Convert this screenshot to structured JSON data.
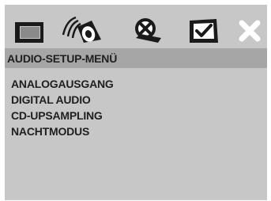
{
  "tabs": [
    {
      "icon": "general-setup-icon"
    },
    {
      "icon": "audio-setup-icon"
    },
    {
      "icon": "video-setup-icon"
    },
    {
      "icon": "preferences-icon"
    },
    {
      "icon": "exit-icon"
    }
  ],
  "menu": {
    "title": "AUDIO-SETUP-MENÜ",
    "items": [
      "ANALOGAUSGANG",
      "DIGITAL AUDIO",
      "CD-UPSAMPLING",
      "NACHTMODUS"
    ]
  },
  "colors": {
    "panel": "#c7c7c7",
    "title_bar": "#a6a6a6",
    "text": "#202020",
    "icon": "#1a1a1a",
    "exit_icon": "#ffffff"
  }
}
